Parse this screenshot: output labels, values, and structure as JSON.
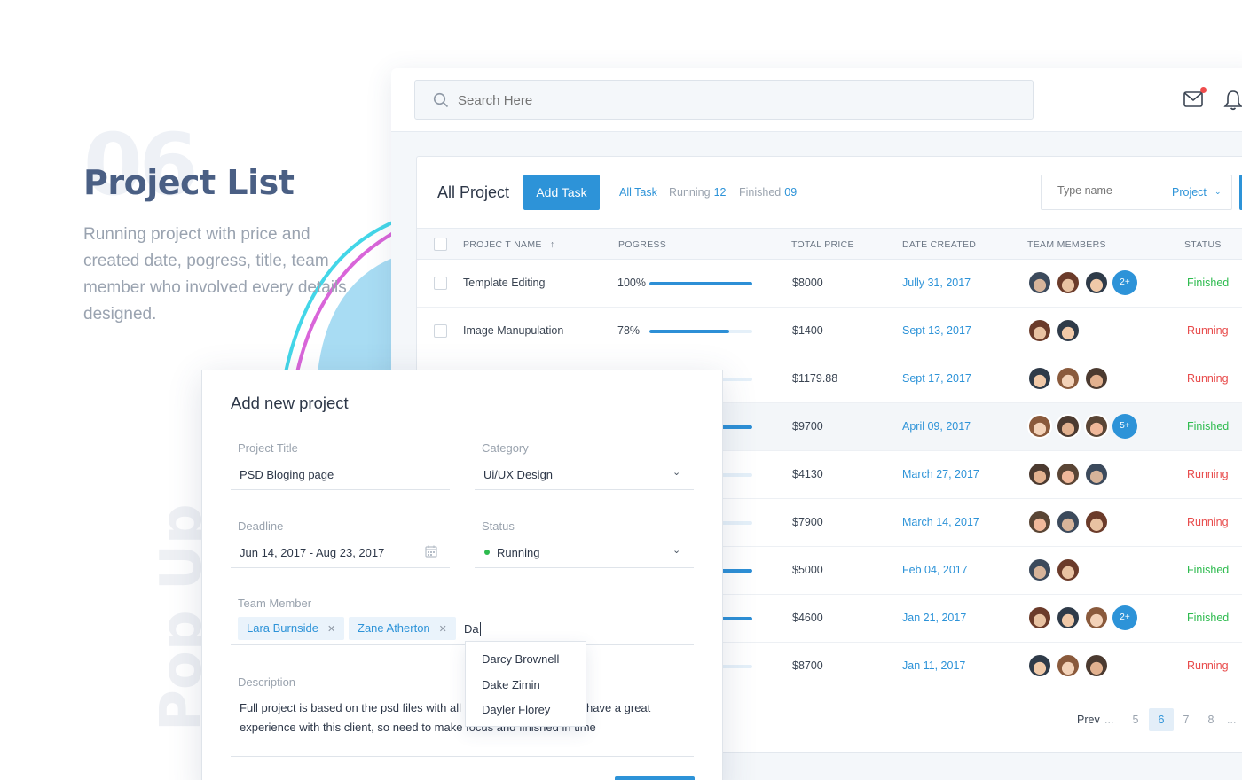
{
  "promo": {
    "number": "06",
    "title": "Project List",
    "text": "Running project with price and created date, pogress, title, team member who involved every details designed.",
    "side_label": "Pop Up"
  },
  "topbar": {
    "search_placeholder": "Search Here",
    "icons": [
      "search-icon",
      "mail-icon",
      "bell-icon"
    ]
  },
  "panel": {
    "title": "All Project",
    "add_task_label": "Add Task",
    "tabs": [
      {
        "label": "All Task",
        "count": ""
      },
      {
        "label": "Running",
        "count": "12"
      },
      {
        "label": "Finished",
        "count": "09"
      }
    ],
    "name_filter_placeholder": "Type name",
    "project_select": "Project",
    "columns": [
      "PROJEC T NAME",
      "POGRESS",
      "TOTAL PRICE",
      "DATE CREATED",
      "TEAM MEMBERS",
      "STATUS"
    ],
    "rows": [
      {
        "name": "Template Editing",
        "progress": "100%",
        "progress_value": 100,
        "price": "$8000",
        "date": "Jully 31, 2017",
        "members": 3,
        "extra": "2+",
        "status": "Finished"
      },
      {
        "name": "Image Manupulation",
        "progress": "78%",
        "progress_value": 78,
        "price": "$1400",
        "date": "Sept 13, 2017",
        "members": 2,
        "extra": "",
        "status": "Running"
      },
      {
        "name": "",
        "progress": "",
        "progress_value": 0,
        "price": "$1179.88",
        "date": "Sept 17, 2017",
        "members": 3,
        "extra": "",
        "status": "Running"
      },
      {
        "name": "",
        "progress": "",
        "progress_value": 100,
        "price": "$9700",
        "date": "April 09, 2017",
        "members": 3,
        "extra": "5+",
        "status": "Finished"
      },
      {
        "name": "",
        "progress": "",
        "progress_value": 30,
        "price": "$4130",
        "date": "March 27, 2017",
        "members": 3,
        "extra": "",
        "status": "Running"
      },
      {
        "name": "",
        "progress": "",
        "progress_value": 0,
        "price": "$7900",
        "date": "March 14, 2017",
        "members": 3,
        "extra": "",
        "status": "Running"
      },
      {
        "name": "",
        "progress": "",
        "progress_value": 100,
        "price": "$5000",
        "date": "Feb 04, 2017",
        "members": 2,
        "extra": "",
        "status": "Finished"
      },
      {
        "name": "",
        "progress": "",
        "progress_value": 100,
        "price": "$4600",
        "date": "Jan 21, 2017",
        "members": 3,
        "extra": "2+",
        "status": "Finished"
      },
      {
        "name": "",
        "progress": "",
        "progress_value": 20,
        "price": "$8700",
        "date": "Jan 11, 2017",
        "members": 3,
        "extra": "",
        "status": "Running"
      }
    ],
    "pagination": {
      "prev": "Prev",
      "dots": "...",
      "pages": [
        "5",
        "6",
        "7",
        "8"
      ],
      "active": "6",
      "trailing": "..."
    }
  },
  "modal": {
    "title": "Add new project",
    "project_title_label": "Project Title",
    "project_title_value": "PSD Bloging page",
    "category_label": "Category",
    "category_value": "Ui/UX Design",
    "deadline_label": "Deadline",
    "deadline_value": "Jun 14, 2017 - Aug 23, 2017",
    "status_label": "Status",
    "status_value": "Running",
    "team_label": "Team Member",
    "team_members": [
      "Lara Burnside",
      "Zane Atherton"
    ],
    "team_input": "Da",
    "suggestions": [
      "Darcy Brownell",
      "Dake Zimin",
      "Dayler Florey"
    ],
    "description_label": "Description",
    "description_line1_left": "Full project is based on the psd files with all",
    "description_line1_right": "have a great",
    "description_line2": "experience with this client, so need to make focus and finished in time"
  },
  "colors": {
    "accent": "#2d93d8",
    "finished": "#2dbb4e",
    "running": "#e84b4b",
    "promo_title": "#4a5f84"
  }
}
